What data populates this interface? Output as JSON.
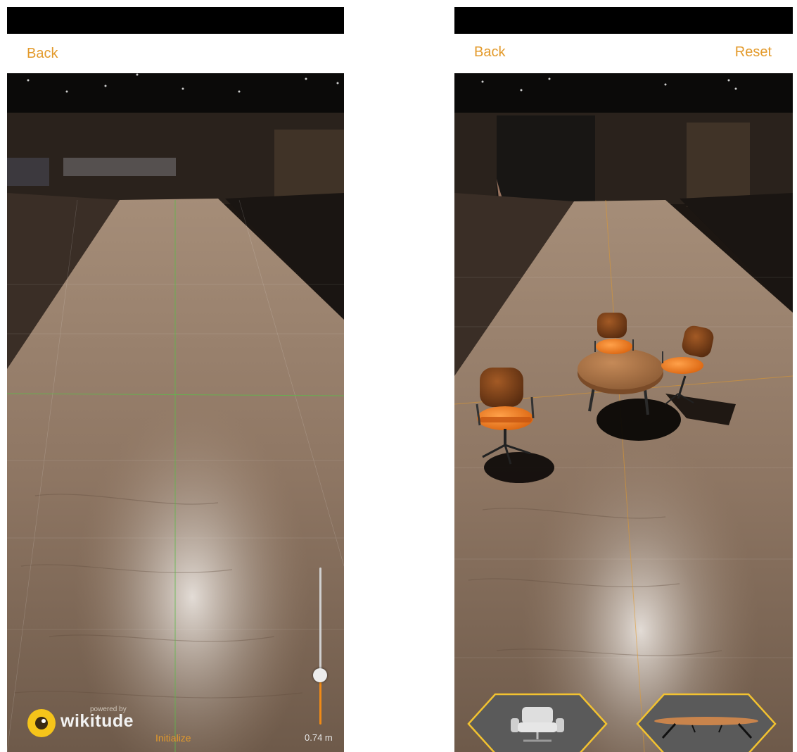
{
  "left_screen": {
    "nav": {
      "back_label": "Back"
    },
    "brand": {
      "powered_text": "powered by",
      "wordmark": "wikitude"
    },
    "controls": {
      "initialize_label": "Initialize",
      "distance_readout": "0.74 m",
      "slider_level_fraction": 0.32
    }
  },
  "right_screen": {
    "nav": {
      "back_label": "Back",
      "reset_label": "Reset"
    },
    "model_buttons": [
      {
        "model": "office-chair",
        "icon": "chair-icon"
      },
      {
        "model": "coffee-table",
        "icon": "table-icon"
      }
    ]
  },
  "colors": {
    "accent": "#e39a2b",
    "slider_fill": "#f08a16",
    "hex_border": "#f2c230",
    "chair_orange": "#f07b1b"
  }
}
